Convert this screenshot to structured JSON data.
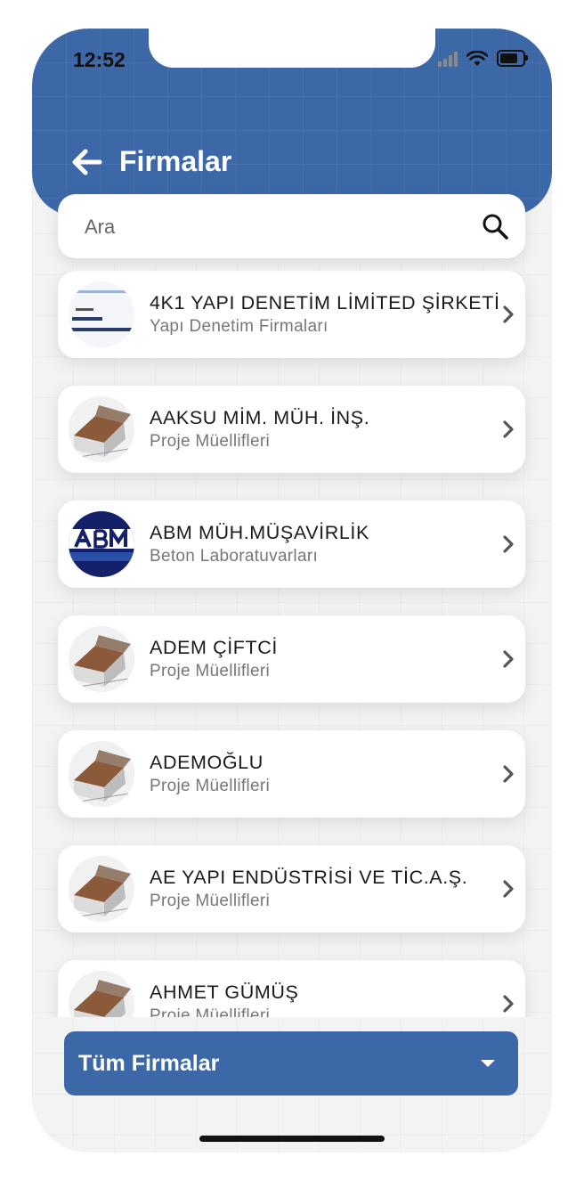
{
  "status_bar": {
    "time": "12:52"
  },
  "header": {
    "title": "Firmalar"
  },
  "search": {
    "placeholder": "Ara"
  },
  "firms": [
    {
      "name": "4K1 YAPI DENETİM LİMİTED ŞİRKETİ",
      "category": "Yapı Denetim Firmaları",
      "avatar": "document-logo"
    },
    {
      "name": "AAKSU MİM. MÜH. İNŞ.",
      "category": "Proje Müellifleri",
      "avatar": "house-sketch"
    },
    {
      "name": "ABM MÜH.MÜŞAVİRLİK",
      "category": "Beton Laboratuvarları",
      "avatar": "abm-logo"
    },
    {
      "name": "ADEM ÇİFTCİ",
      "category": "Proje Müellifleri",
      "avatar": "house-sketch"
    },
    {
      "name": "ADEMOĞLU",
      "category": "Proje Müellifleri",
      "avatar": "house-sketch"
    },
    {
      "name": "AE YAPI ENDÜSTRİSİ VE TİC.A.Ş.",
      "category": "Proje Müellifleri",
      "avatar": "house-sketch"
    },
    {
      "name": "AHMET GÜMÜŞ",
      "category": "Proje Müellifleri",
      "avatar": "house-sketch"
    }
  ],
  "filter": {
    "selected": "Tüm Firmalar"
  },
  "colors": {
    "primary": "#3d68a8",
    "card": "#ffffff",
    "subtitle": "#777777"
  }
}
